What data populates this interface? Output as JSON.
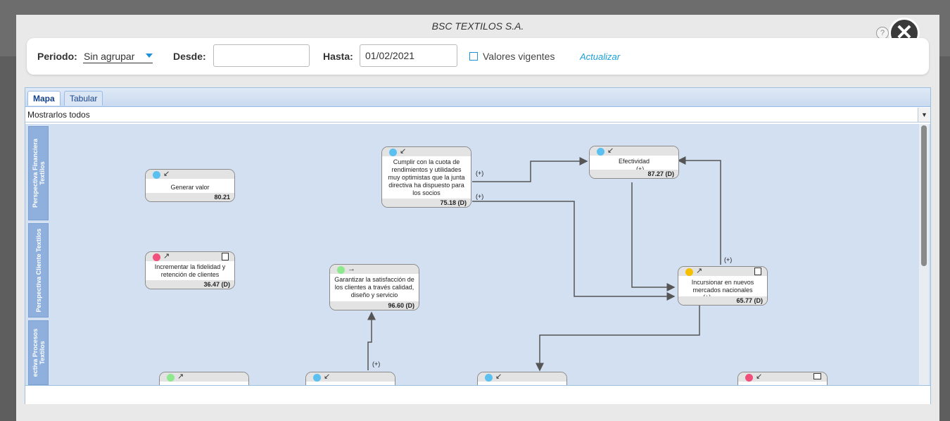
{
  "modal": {
    "title": "BSC TEXTILOS S.A.",
    "help": "?",
    "close": "✕"
  },
  "filters": {
    "periodo_label": "Periodo:",
    "periodo_value": "Sin agrupar",
    "desde_label": "Desde:",
    "desde_value": "",
    "hasta_label": "Hasta:",
    "hasta_value": "01/02/2021",
    "vigentes_label": "Valores vigentes",
    "actualizar": "Actualizar"
  },
  "tabs": {
    "mapa": "Mapa",
    "tabular": "Tabular"
  },
  "combo": {
    "value": "Mostrarlos todos"
  },
  "lanes": {
    "financiera": "Perspectiva Financiera Textilos",
    "cliente": "Perspectiva Cliente Textilos",
    "procesos": "ectiva Procesos Textilos"
  },
  "nodes": {
    "generar": {
      "label": "Generar valor",
      "value": "80.21",
      "color": "#5bc0f0",
      "trend": "↙"
    },
    "cumplir": {
      "label": "Cumplir con la cuota de rendimientos y utilidades muy optimistas que la junta directiva ha dispuesto para los socios",
      "value": "75.18 (D)",
      "color": "#5bc0f0",
      "trend": "↙"
    },
    "efectividad": {
      "label": "Efectividad",
      "value": "87.27 (D)",
      "color": "#5bc0f0",
      "trend": "↙"
    },
    "fidelidad": {
      "label": "Incrementar la fidelidad y retención de clientes",
      "value": "36.47 (D)",
      "color": "#f0507a",
      "trend": "↗"
    },
    "satisfaccion": {
      "label": "Garantizar la satisfacción de los clientes a través calidad, diseño y servicio",
      "value": "96.60 (D)",
      "color": "#8ee88e",
      "trend": "→"
    },
    "mercados": {
      "label": "Incursionar en nuevos mercados nacionales",
      "value": "65.77 (D)",
      "color": "#f5c000",
      "trend": "↗"
    },
    "p1": {
      "color": "#8ee88e",
      "trend": "↗"
    },
    "p2": {
      "color": "#5bc0f0",
      "trend": "↙"
    },
    "p3": {
      "color": "#5bc0f0",
      "trend": "↙"
    },
    "p4": {
      "color": "#f0507a",
      "trend": "↙"
    }
  },
  "link_plus": "(+)",
  "colors": {
    "map_bg": "#d3e0f2",
    "lane": "#8fb0dd",
    "link": "#1aa0d8"
  }
}
